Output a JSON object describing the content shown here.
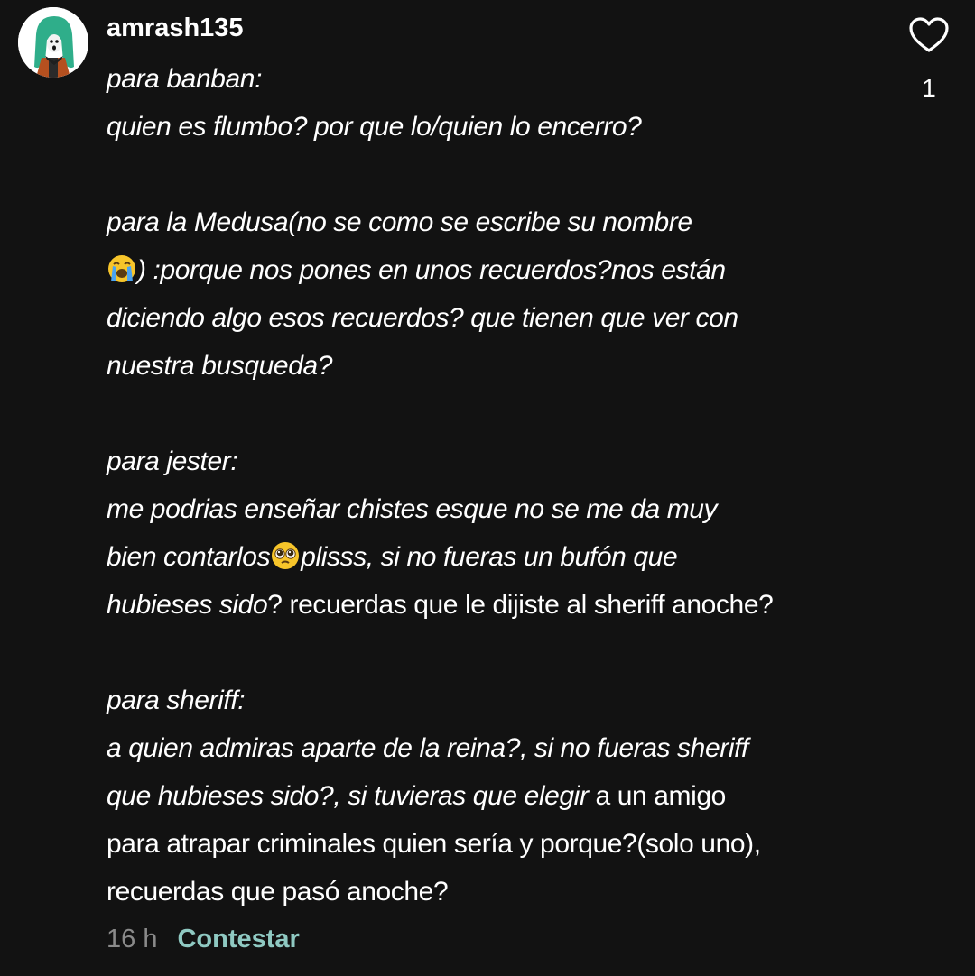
{
  "comment": {
    "username": "amrash135",
    "like_count": "1",
    "timestamp": "16 h",
    "reply_label": "Contestar",
    "lines": {
      "l1": "para banban:",
      "l2": "quien es flumbo? por que lo/quien lo encerro?",
      "l3": "para la Medusa(no se como se escribe su nombre",
      "l4": ") :porque nos pones en unos recuerdos?nos están",
      "l5": "diciendo algo esos recuerdos? que tienen que ver con",
      "l6": "nuestra busqueda?",
      "l7": "para jester:",
      "l8": "me podrias enseñar chistes esque no se me da muy",
      "l9a": "bien contarlos",
      "l9b": "plisss, si no fueras un bufón que",
      "l10a": "hubieses sido",
      "l10b": "? recuerdas que le dijiste al sheriff anoche?",
      "l11": "para sheriff:",
      "l12": "a quien admiras aparte de la reina?, si no fueras sheriff",
      "l13a": "que hubieses sido?, si tuvieras que elegir",
      "l13b": " a un amigo",
      "l14": "para atrapar criminales quien sería y porque?(solo uno),",
      "l15": "recuerdas que pasó anoche?"
    }
  },
  "icons": {
    "avatar": "avatar-green-hair-character",
    "heart": "heart-outline-icon",
    "crying": "loudly-crying-face-emoji",
    "pleading": "pleading-face-emoji"
  },
  "colors": {
    "background": "#121212",
    "text": "#ffffff",
    "timestamp": "#8a8a8a",
    "reply": "#8fc9c2"
  }
}
